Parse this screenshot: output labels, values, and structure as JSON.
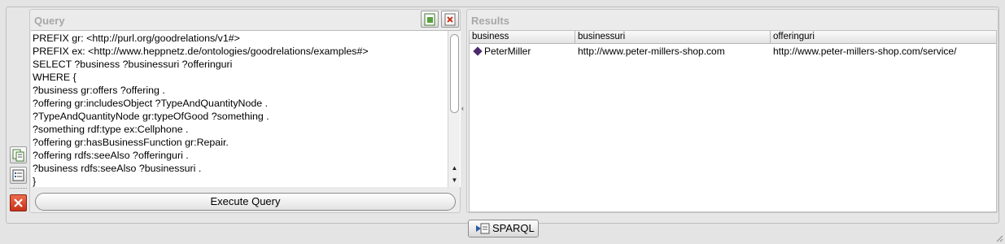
{
  "query_panel": {
    "title": "Query",
    "lines": [
      "PREFIX gr: <http://purl.org/goodrelations/v1#>",
      "PREFIX ex: <http://www.heppnetz.de/ontologies/goodrelations/examples#>",
      "SELECT ?business ?businessuri ?offeringuri",
      "WHERE {",
      "?business gr:offers ?offering .",
      "?offering gr:includesObject ?TypeAndQuantityNode .",
      "?TypeAndQuantityNode gr:typeOfGood ?something .",
      "?something rdf:type ex:Cellphone .",
      "?offering gr:hasBusinessFunction gr:Repair.",
      "?offering rdfs:seeAlso ?offeringuri .",
      "?business rdfs:seeAlso ?businessuri .",
      "}"
    ],
    "execute_label": "Execute Query"
  },
  "results_panel": {
    "title": "Results",
    "columns": [
      "business",
      "businessuri",
      "offeringuri"
    ],
    "rows": [
      [
        "PeterMiller",
        "http://www.peter-millers-shop.com",
        "http://www.peter-millers-shop.com/service/"
      ]
    ]
  },
  "bottom_tab": {
    "label": "SPARQL"
  }
}
